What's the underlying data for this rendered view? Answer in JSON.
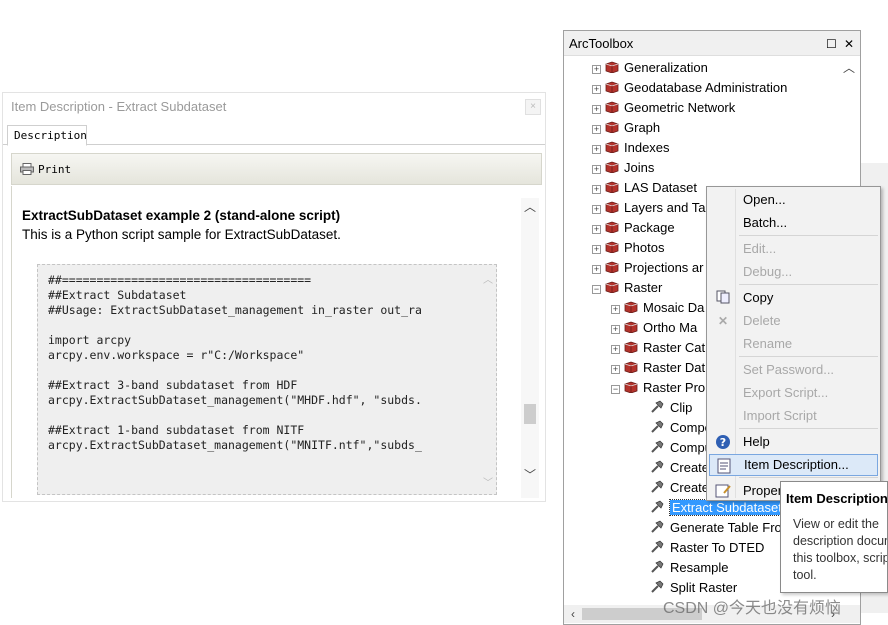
{
  "item_description_window": {
    "title": "Item Description - Extract Subdataset",
    "tab_label": "Description",
    "print_label": "Print",
    "heading": "ExtractSubDataset example 2 (stand-alone script)",
    "subtext": "This is a Python script sample for ExtractSubDataset.",
    "code_lines": [
      "##====================================",
      "##Extract Subdataset",
      "##Usage: ExtractSubDataset_management in_raster out_ra",
      "",
      "import arcpy",
      "arcpy.env.workspace = r\"C:/Workspace\"",
      "",
      "##Extract 3-band subdataset from HDF",
      "arcpy.ExtractSubDataset_management(\"MHDF.hdf\", \"subds.",
      "",
      "##Extract 1-band subdataset from NITF",
      "arcpy.ExtractSubDataset_management(\"MNITF.ntf\",\"subds_"
    ]
  },
  "arctoolbox": {
    "title": "ArcToolbox",
    "items": [
      {
        "label": "Generalization",
        "level": 0,
        "expander": "+",
        "icon": "toolbox-icon"
      },
      {
        "label": "Geodatabase Administration",
        "level": 0,
        "expander": "+",
        "icon": "toolbox-icon"
      },
      {
        "label": "Geometric Network",
        "level": 0,
        "expander": "+",
        "icon": "toolbox-icon"
      },
      {
        "label": "Graph",
        "level": 0,
        "expander": "+",
        "icon": "toolbox-icon"
      },
      {
        "label": "Indexes",
        "level": 0,
        "expander": "+",
        "icon": "toolbox-icon"
      },
      {
        "label": "Joins",
        "level": 0,
        "expander": "+",
        "icon": "toolbox-icon"
      },
      {
        "label": "LAS Dataset",
        "level": 0,
        "expander": "+",
        "icon": "toolbox-icon"
      },
      {
        "label": "Layers and Ta",
        "level": 0,
        "expander": "+",
        "icon": "toolbox-icon"
      },
      {
        "label": "Package",
        "level": 0,
        "expander": "+",
        "icon": "toolbox-icon"
      },
      {
        "label": "Photos",
        "level": 0,
        "expander": "+",
        "icon": "toolbox-icon"
      },
      {
        "label": "Projections ar",
        "level": 0,
        "expander": "+",
        "icon": "toolbox-icon"
      },
      {
        "label": "Raster",
        "level": 0,
        "expander": "−",
        "icon": "toolbox-icon"
      },
      {
        "label": "Mosaic Da",
        "level": 1,
        "expander": "+",
        "icon": "toolbox-icon"
      },
      {
        "label": "Ortho Ma",
        "level": 1,
        "expander": "+",
        "icon": "toolbox-icon"
      },
      {
        "label": "Raster Cat",
        "level": 1,
        "expander": "+",
        "icon": "toolbox-icon"
      },
      {
        "label": "Raster Dat",
        "level": 1,
        "expander": "+",
        "icon": "toolbox-icon"
      },
      {
        "label": "Raster Pro",
        "level": 1,
        "expander": "−",
        "icon": "toolbox-icon"
      },
      {
        "label": "Clip",
        "level": 2,
        "expander": "",
        "icon": "hammer-icon"
      },
      {
        "label": "Compo",
        "level": 2,
        "expander": "",
        "icon": "hammer-icon"
      },
      {
        "label": "Compu",
        "level": 2,
        "expander": "",
        "icon": "hammer-icon"
      },
      {
        "label": "Create",
        "level": 2,
        "expander": "",
        "icon": "hammer-icon"
      },
      {
        "label": "Create",
        "level": 2,
        "expander": "",
        "icon": "hammer-icon"
      },
      {
        "label": "Extract Subdataset",
        "level": 2,
        "expander": "",
        "icon": "hammer-icon",
        "selected": true
      },
      {
        "label": "Generate Table Fro",
        "level": 2,
        "expander": "",
        "icon": "hammer-icon"
      },
      {
        "label": "Raster To DTED",
        "level": 2,
        "expander": "",
        "icon": "hammer-icon"
      },
      {
        "label": "Resample",
        "level": 2,
        "expander": "",
        "icon": "hammer-icon"
      },
      {
        "label": "Split Raster",
        "level": 2,
        "expander": "",
        "icon": "hammer-icon"
      }
    ]
  },
  "context_menu": {
    "items": [
      {
        "label": "Open...",
        "enabled": true,
        "icon": ""
      },
      {
        "label": "Batch...",
        "enabled": true,
        "icon": ""
      },
      {
        "label": "Edit...",
        "enabled": false,
        "icon": ""
      },
      {
        "label": "Debug...",
        "enabled": false,
        "icon": ""
      },
      {
        "label": "Copy",
        "enabled": true,
        "icon": "copy-icon"
      },
      {
        "label": "Delete",
        "enabled": false,
        "icon": "delete-icon"
      },
      {
        "label": "Rename",
        "enabled": false,
        "icon": ""
      },
      {
        "label": "Set Password...",
        "enabled": false,
        "icon": ""
      },
      {
        "label": "Export Script...",
        "enabled": false,
        "icon": ""
      },
      {
        "label": "Import Script",
        "enabled": false,
        "icon": ""
      },
      {
        "label": "Help",
        "enabled": true,
        "icon": "help-icon"
      },
      {
        "label": "Item Description...",
        "enabled": true,
        "icon": "item-description-icon",
        "highlighted": true
      },
      {
        "label": "Properties...",
        "enabled": true,
        "icon": "properties-icon"
      }
    ]
  },
  "tooltip": {
    "title": "Item Description",
    "body": "View or edit the description document for this toolbox, script or tool."
  },
  "watermark": "CSDN @今天也没有烦恼",
  "colors": {
    "selection": "#3399ff",
    "menu_highlight": "#dce9f8",
    "toolbox_red": "#b3322b"
  }
}
